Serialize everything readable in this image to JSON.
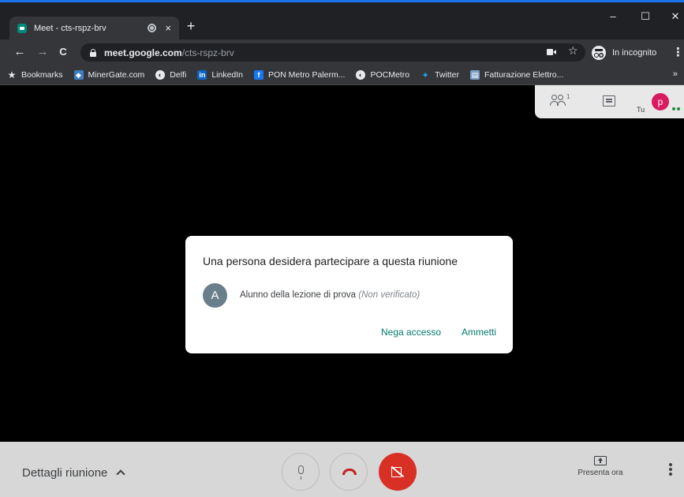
{
  "browser": {
    "tab_title": "Meet - cts-rspz-brv",
    "tab_close": "×",
    "new_tab": "+",
    "win_minimize": "–",
    "win_maximize": "☐",
    "win_close": "✕",
    "nav_back": "←",
    "nav_forward": "→",
    "nav_reload": "C",
    "url_host": "meet.google.com",
    "url_path": "/cts-rspz-brv",
    "star": "☆",
    "incognito_label": "In incognito",
    "menu": "⋮",
    "bookmarks": [
      {
        "label": "Bookmarks",
        "icon": "★"
      },
      {
        "label": "MinerGate.com",
        "icon": "◆"
      },
      {
        "label": "Delfi",
        "icon": "◐"
      },
      {
        "label": "LinkedIn",
        "icon": "in"
      },
      {
        "label": "PON Metro Palerm...",
        "icon": "f"
      },
      {
        "label": "POCMetro",
        "icon": "◐"
      },
      {
        "label": "Twitter",
        "icon": "✦"
      },
      {
        "label": "Fatturazione Elettro...",
        "icon": "▤"
      }
    ],
    "bookmarks_more": "»"
  },
  "meet": {
    "people_count": "1",
    "self_label": "Tu",
    "self_initial": "p",
    "dialog": {
      "title": "Una persona desidera partecipare a questa riunione",
      "requester_initial": "A",
      "requester_name": "Alunno della lezione di prova",
      "requester_status": "(Non verificato)",
      "deny_label": "Nega accesso",
      "admit_label": "Ammetti"
    },
    "details_label": "Dettagli riunione",
    "present_label": "Presenta ora"
  },
  "colors": {
    "accent": "#00796b",
    "hangup": "#c5221f",
    "camera_off": "#d93025",
    "self_avatar": "#d81b60",
    "requester_avatar": "#6a7f8c"
  }
}
